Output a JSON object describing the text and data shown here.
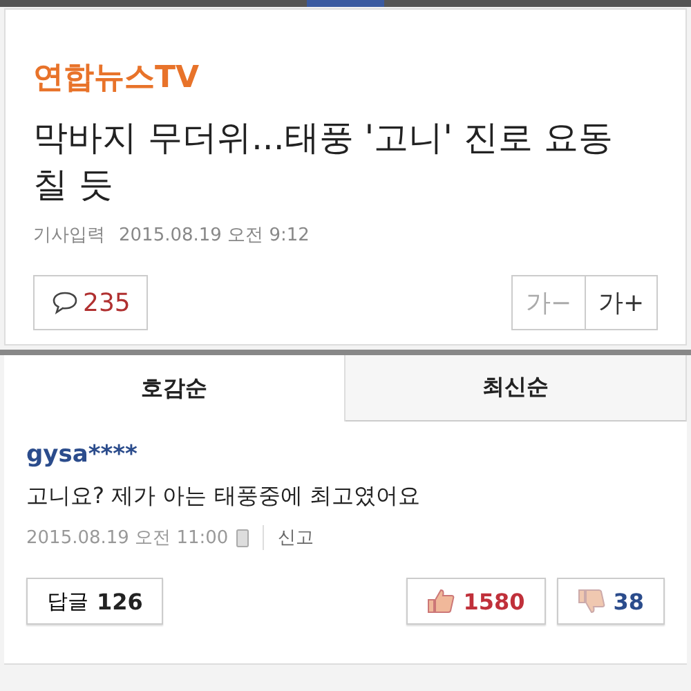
{
  "article": {
    "source": "연합뉴스TV",
    "headline": "막바지 무더위...태풍 '고니' 진로 요동칠 듯",
    "meta_label": "기사입력",
    "date": "2015.08.19 오전 9:12",
    "comment_count": "235",
    "font_buttons": [
      {
        "label": "가−",
        "disabled": true
      },
      {
        "label": "가+",
        "disabled": false
      }
    ]
  },
  "tabs": [
    {
      "label": "호감순",
      "selected": true
    },
    {
      "label": "최신순",
      "selected": false
    }
  ],
  "comment": {
    "user": "gysa****",
    "text": "고니요? 제가 아는 태풍중에 최고였어요",
    "date": "2015.08.19 오전 11:00",
    "report": "신고",
    "reply_label": "답글",
    "reply_count": "126",
    "likes": "1580",
    "dislikes": "38"
  }
}
